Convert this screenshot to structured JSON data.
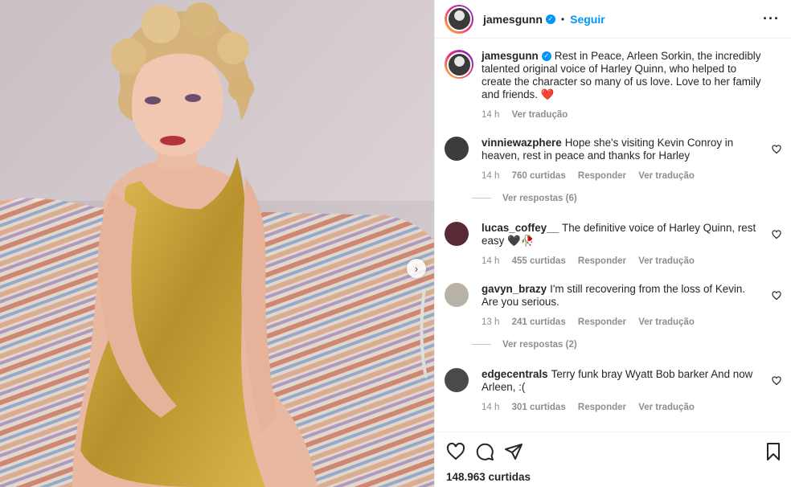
{
  "post": {
    "nav": {
      "next_icon": "chevron-right-icon"
    },
    "header": {
      "username": "jamesgunn",
      "verified_icon": "verified-badge-icon",
      "separator": "•",
      "follow_label": "Seguir",
      "more_icon": "more-options-icon"
    },
    "caption": {
      "username": "jamesgunn",
      "text": "Rest in Peace, Arleen Sorkin, the incredibly talented original voice of Harley Quinn, who helped to create the character so many of us love. Love to her family and friends. ❤️",
      "time": "14 h",
      "translate": "Ver tradução"
    },
    "comments": [
      {
        "username": "vinniewazphere",
        "text": "Hope she's visiting Kevin Conroy in heaven, rest in peace and thanks for Harley",
        "time": "14 h",
        "likes": "760 curtidas",
        "reply": "Responder",
        "translate": "Ver tradução",
        "view_replies": "Ver respostas (6)"
      },
      {
        "username": "lucas_coffey__",
        "text": "The definitive voice of Harley Quinn, rest easy 🖤🥀",
        "time": "14 h",
        "likes": "455 curtidas",
        "reply": "Responder",
        "translate": "Ver tradução",
        "view_replies": ""
      },
      {
        "username": "gavyn_brazy",
        "text": "I'm still recovering from the loss of Kevin. Are you serious.",
        "time": "13 h",
        "likes": "241 curtidas",
        "reply": "Responder",
        "translate": "Ver tradução",
        "view_replies": "Ver respostas (2)"
      },
      {
        "username": "edgecentrals",
        "text": "Terry funk bray Wyatt Bob barker And now Arleen, :(",
        "time": "14 h",
        "likes": "301 curtidas",
        "reply": "Responder",
        "translate": "Ver tradução",
        "view_replies": ""
      }
    ],
    "actions": {
      "like_icon": "heart-icon",
      "comment_icon": "comment-icon",
      "share_icon": "share-icon",
      "save_icon": "bookmark-icon",
      "likes_count": "148.963 curtidas"
    }
  },
  "colors": {
    "link": "#0095f6",
    "muted": "#8e8e8e",
    "text": "#262626"
  }
}
